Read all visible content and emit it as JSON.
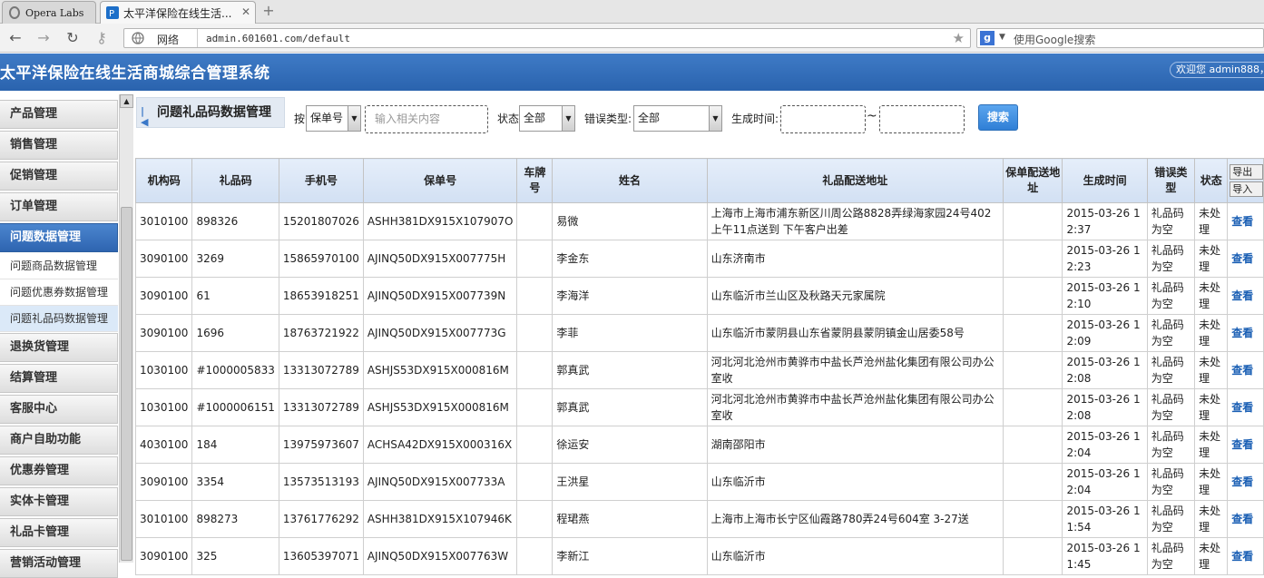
{
  "browser": {
    "tabs": [
      {
        "label": "Opera Labs"
      },
      {
        "label": "太平洋保险在线生活..."
      }
    ],
    "network_label": "网络",
    "url": "admin.601601.com/default",
    "search_placeholder": "使用Google搜索"
  },
  "header": {
    "title": "太平洋保险在线生活商城综合管理系统",
    "welcome": "欢迎您 admin888，"
  },
  "sidebar": {
    "menus": [
      {
        "label": "产品管理"
      },
      {
        "label": "销售管理"
      },
      {
        "label": "促销管理"
      },
      {
        "label": "订单管理"
      },
      {
        "label": "问题数据管理"
      }
    ],
    "submenus": [
      {
        "label": "问题商品数据管理"
      },
      {
        "label": "问题优惠券数据管理"
      },
      {
        "label": "问题礼品码数据管理"
      }
    ],
    "menus2": [
      {
        "label": "退换货管理"
      },
      {
        "label": "结算管理"
      },
      {
        "label": "客服中心"
      },
      {
        "label": "商户自助功能"
      },
      {
        "label": "优惠券管理"
      },
      {
        "label": "实体卡管理"
      },
      {
        "label": "礼品卡管理"
      },
      {
        "label": "营销活动管理"
      }
    ]
  },
  "page": {
    "title": "问题礼品码数据管理"
  },
  "filters": {
    "by_label": "按",
    "by_value": "保单号",
    "keyword_placeholder": "输入相关内容",
    "status_label": "状态",
    "status_value": "全部",
    "error_label": "错误类型:",
    "error_value": "全部",
    "time_label": "生成时间:",
    "tilde": "~",
    "search_label": "搜索"
  },
  "table": {
    "headers": [
      "机构码",
      "礼品码",
      "手机号",
      "保单号",
      "车牌号",
      "姓名",
      "礼品配送地址",
      "保单配送地址",
      "生成时间",
      "错误类型",
      "状态"
    ],
    "export_label": "导出",
    "import_label": "导入",
    "action_label": "查看",
    "rows": [
      [
        "3010100",
        "898326",
        "15201807026",
        "ASHH381DX915X107907O",
        "",
        "易微",
        "上海市上海市浦东新区川周公路8828弄绿海家园24号402 上午11点送到 下午客户出差",
        "",
        "2015-03-26 12:37",
        "礼品码为空",
        "未处理"
      ],
      [
        "3090100",
        "3269",
        "15865970100",
        "AJINQ50DX915X007775H",
        "",
        "李金东",
        "山东济南市",
        "",
        "2015-03-26 12:23",
        "礼品码为空",
        "未处理"
      ],
      [
        "3090100",
        "61",
        "18653918251",
        "AJINQ50DX915X007739N",
        "",
        "李海洋",
        "山东临沂市兰山区及秋路天元家属院",
        "",
        "2015-03-26 12:10",
        "礼品码为空",
        "未处理"
      ],
      [
        "3090100",
        "1696",
        "18763721922",
        "AJINQ50DX915X007773G",
        "",
        "李菲",
        "山东临沂市蒙阴县山东省蒙阴县蒙阴镇金山居委58号",
        "",
        "2015-03-26 12:09",
        "礼品码为空",
        "未处理"
      ],
      [
        "1030100",
        "#1000005833",
        "13313072789",
        "ASHJS53DX915X000816M",
        "",
        "郭真武",
        "河北河北沧州市黄骅市中盐长芦沧州盐化集团有限公司办公室收",
        "",
        "2015-03-26 12:08",
        "礼品码为空",
        "未处理"
      ],
      [
        "1030100",
        "#1000006151",
        "13313072789",
        "ASHJS53DX915X000816M",
        "",
        "郭真武",
        "河北河北沧州市黄骅市中盐长芦沧州盐化集团有限公司办公室收",
        "",
        "2015-03-26 12:08",
        "礼品码为空",
        "未处理"
      ],
      [
        "4030100",
        "184",
        "13975973607",
        "ACHSA42DX915X000316X",
        "",
        "徐运安",
        "湖南邵阳市",
        "",
        "2015-03-26 12:04",
        "礼品码为空",
        "未处理"
      ],
      [
        "3090100",
        "3354",
        "13573513193",
        "AJINQ50DX915X007733A",
        "",
        "王洪星",
        "山东临沂市",
        "",
        "2015-03-26 12:04",
        "礼品码为空",
        "未处理"
      ],
      [
        "3010100",
        "898273",
        "13761776292",
        "ASHH381DX915X107946K",
        "",
        "程珺燕",
        "上海市上海市长宁区仙霞路780弄24号604室 3-27送",
        "",
        "2015-03-26 11:54",
        "礼品码为空",
        "未处理"
      ],
      [
        "3090100",
        "325",
        "13605397071",
        "AJINQ50DX915X007763W",
        "",
        "李新江",
        "山东临沂市",
        "",
        "2015-03-26 11:45",
        "礼品码为空",
        "未处理"
      ]
    ]
  }
}
